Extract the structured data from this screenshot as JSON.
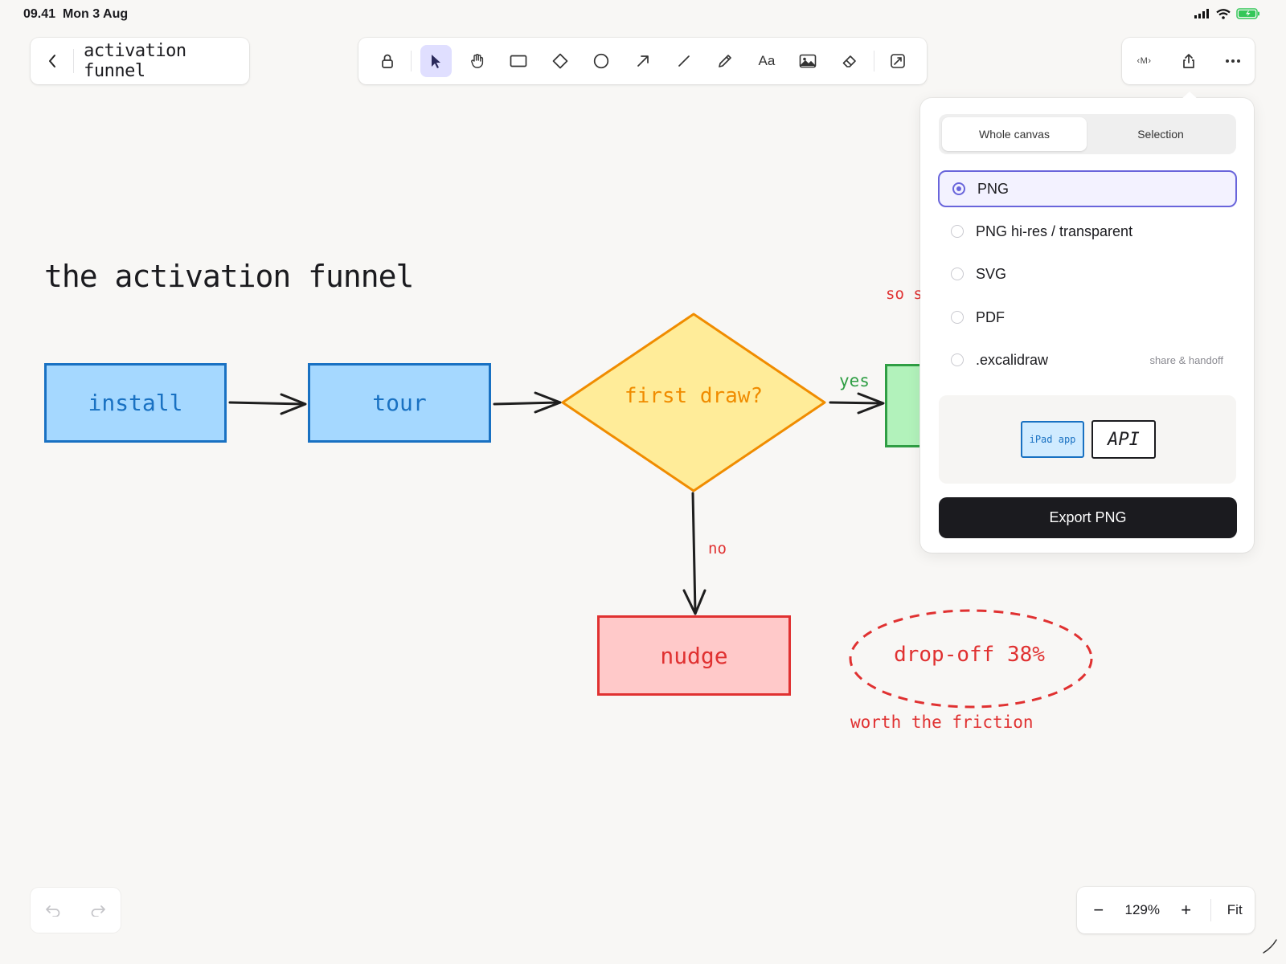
{
  "status": {
    "time": "09.41",
    "date": "Mon 3 Aug"
  },
  "document": {
    "title": "activation funnel"
  },
  "toolbar": {
    "tools": [
      "lock-icon",
      "pointer-icon",
      "hand-icon",
      "rectangle-icon",
      "diamond-icon",
      "ellipse-icon",
      "arrow-icon",
      "line-icon",
      "pencil-icon",
      "text-icon",
      "image-icon",
      "eraser-icon",
      "frame-icon"
    ],
    "active_tool": "pointer",
    "text_tool_label": "Aa"
  },
  "header_right": {
    "markdown_label": "‹M›"
  },
  "canvas": {
    "title": "the activation funnel",
    "nodes": {
      "install": "install",
      "tour": "tour",
      "decision": "first draw?",
      "nudge": "nudge"
    },
    "edge_labels": {
      "yes": "yes",
      "no": "no"
    },
    "note_partial": "so s",
    "dropoff": "drop-off 38%",
    "annotation": "worth the friction"
  },
  "export_panel": {
    "scope_tabs": [
      "Whole canvas",
      "Selection"
    ],
    "active_scope": "Whole canvas",
    "formats": [
      {
        "label": "PNG",
        "selected": true,
        "hint": ""
      },
      {
        "label": "PNG hi-res / transparent",
        "selected": false,
        "hint": ""
      },
      {
        "label": "SVG",
        "selected": false,
        "hint": ""
      },
      {
        "label": "PDF",
        "selected": false,
        "hint": ""
      },
      {
        "label": ".excalidraw",
        "selected": false,
        "hint": "share & handoff"
      }
    ],
    "preview": {
      "ipad_label": "iPad app",
      "api_label": "API"
    },
    "export_button": "Export PNG"
  },
  "zoom": {
    "value": "129%",
    "fit_label": "Fit",
    "minus": "−",
    "plus": "+"
  },
  "colors": {
    "accent": "#6965db",
    "blue_fill": "#a5d8ff",
    "blue_stroke": "#1971c2",
    "yellow_fill": "#ffec99",
    "yellow_stroke": "#f08c00",
    "red_fill": "#ffc9c9",
    "red_stroke": "#e03131",
    "green_fill": "#b2f2bb",
    "green_stroke": "#2f9e44"
  }
}
